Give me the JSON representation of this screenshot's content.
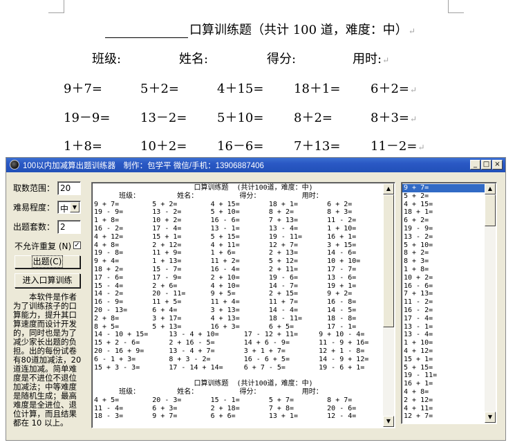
{
  "document": {
    "title": "口算训练题（共计 100 道，难度：中）",
    "info_labels": [
      "班级:",
      "姓名:",
      "得分:",
      "用时:"
    ],
    "problems": [
      [
        "9＋7=",
        "5＋2=",
        "4＋15=",
        "18＋1=",
        "6＋2="
      ],
      [
        "19－9=",
        "13－2=",
        "5＋10=",
        "8＋2=",
        "8＋3="
      ],
      [
        "1＋8=",
        "10＋2=",
        "16－6=",
        "7＋13=",
        "11－2="
      ]
    ],
    "paragraph_mark": "↵"
  },
  "window": {
    "title": "100以内加减算出题训练器　制作：包学平 微信/手机：13906887406",
    "controls": {
      "minimize": "_",
      "maximize": "□",
      "close": "×"
    },
    "form": {
      "range_label": "取数范围：",
      "range_value": "20",
      "difficulty_label": "难易程度：",
      "difficulty_value": "中",
      "sets_label": "出题套数：",
      "sets_value": "2",
      "no_repeat_label": "不允许重复 (N)",
      "no_repeat_checked": "✓",
      "generate_button": "出题(C)",
      "train_button": "进入口算训练"
    },
    "description": "本软件是作者为了训练孩子的口算能力，提升其口算速度而设计开发的，同时也是为了减少家长出题的负担。出的每份试卷有80道加减法，20道连加减。简单难度是不进位不退位加减法；中等难度是随机生成；最高难度是全进位、退位计算，而且结果都在 10 以上。",
    "main_text": "                        口算训练题  (共计100道，难度：中)\n      班级：         姓名：          得分：          用时：\n9 + 7=        5 + 2=        4 + 15=       18 + 1=       6 + 2=\n19 - 9=       13 - 2=       5 + 10=       8 + 2=        8 + 3=\n1 + 8=        10 + 2=       16 - 6=       7 + 13=       11 - 2=\n16 - 2=       17 - 4=       13 - 1=       13 - 4=       1 + 10=\n4 + 12=       15 + 1=       5 + 15=       19 - 11=      16 + 1=\n4 + 8=        2 + 12=       4 + 11=       12 + 7=       3 + 15=\n19 - 8=       11 + 9=       1 + 6=        2 + 13=       14 - 6=\n9 + 4=        1 + 13=       11 + 2=       5 + 12=       10 + 10=\n18 + 2=       15 - 7=       16 - 4=       2 + 11=       17 - 7=\n17 - 6=       17 - 9=       2 + 10=       19 - 6=       13 - 6=\n15 - 4=       2 + 6=        4 + 10=       14 - 7=       19 + 1=\n14 - 2=       20 - 11=      9 + 5=        2 + 15=       9 + 2=\n16 - 9=       11 + 5=       11 + 4=       11 + 7=       16 - 8=\n20 - 13=      6 + 4=        3 + 13=       14 - 4=       14 - 5=\n2 + 8=        3 + 17=       4 + 13=       18 - 11=      18 - 8=\n8 + 5=        5 + 13=       16 + 3=       6 + 5=        17 - 1=\n14 - 10 + 15=     13 - 4 + 10=      17 - 12 + 11=     9 + 10 - 4=\n15 + 2 - 6=       2 + 16 - 5=       14 + 6 - 9=       11 - 9 + 16=\n20 - 16 + 9=      13 - 4 + 7=       3 + 1 + 7=        12 + 1 - 8=\n6 - 1 + 3=        8 + 3 - 2=        16 - 6 + 5=       14 - 9 + 12=\n15 + 3 - 3=       17 - 14 + 14=     6 + 7 - 5=        19 - 6 + 1=\n\n                        口算训练题  (共计100道，难度：中)\n      班级：         姓名：          得分：          用时：\n4 + 5=        20 - 3=       15 - 1=       5 + 7=        8 + 7=\n11 - 4=       6 + 3=        2 + 18=       7 + 8=        20 - 6=\n18 - 3=       9 + 7=        6 + 6=        13 + 1=       12 - 4=",
    "answers_text": "9 + 7=\n5 + 2=\n4 + 15=\n18 + 1=\n6 + 2=\n19 - 9=\n13 - 2=\n5 + 10=\n8 + 2=\n8 + 3=\n1 + 8=\n10 + 2=\n16 - 6=\n7 + 13=\n11 - 2=\n16 - 2=\n17 - 4=\n13 - 1=\n13 - 4=\n1 + 10=\n4 + 12=\n15 + 1=\n5 + 15=\n19 - 11=\n16 + 1=\n4 + 8=\n2 + 12=\n4 + 11=\n12 + 7=",
    "answers_selected_index": 0,
    "scroll_up": "▲",
    "scroll_down": "▼"
  }
}
